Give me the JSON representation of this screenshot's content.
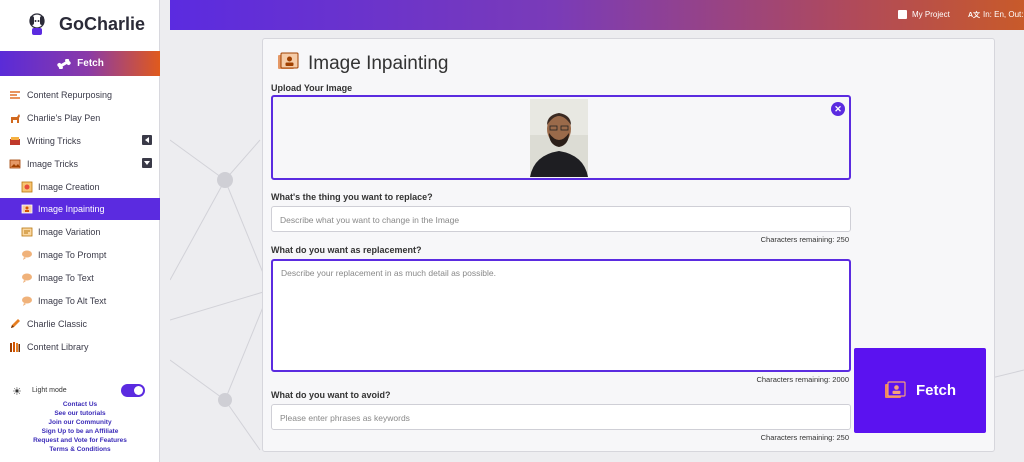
{
  "brand": {
    "name": "GoCharlie"
  },
  "sidebar": {
    "fetch_label": "Fetch",
    "items": [
      {
        "label": "Content Repurposing",
        "icon": "repurpose-icon"
      },
      {
        "label": "Charlie's Play Pen",
        "icon": "dog-icon"
      },
      {
        "label": "Writing Tricks",
        "icon": "writing-icon"
      },
      {
        "label": "Image Tricks",
        "icon": "image-icon"
      },
      {
        "label": "Image Creation",
        "icon": "image-creation-icon"
      },
      {
        "label": "Image Inpainting",
        "icon": "image-inpainting-icon",
        "active": true
      },
      {
        "label": "Image Variation",
        "icon": "image-variation-icon"
      },
      {
        "label": "Image To Prompt",
        "icon": "image-to-prompt-icon"
      },
      {
        "label": "Image To Text",
        "icon": "image-to-text-icon"
      },
      {
        "label": "Image To Alt Text",
        "icon": "image-to-alt-text-icon"
      },
      {
        "label": "Charlie Classic",
        "icon": "pencil-icon"
      },
      {
        "label": "Content Library",
        "icon": "library-icon"
      }
    ],
    "light_mode_label": "Light mode",
    "footer_links": [
      "Contact Us",
      "See our tutorials",
      "Join our Community",
      "Sign Up to be an Affiliate",
      "Request and Vote for Features",
      "Terms & Conditions"
    ]
  },
  "topbar": {
    "project_label": "My Project",
    "language_label": "In: En, Out:"
  },
  "main": {
    "title": "Image Inpainting",
    "upload_label": "Upload Your Image",
    "replace_label": "What's the thing you want to replace?",
    "replace_placeholder": "Describe what you want to change in the Image",
    "replace_count": "Characters remaining: 250",
    "replacement_label": "What do you want as replacement?",
    "replacement_placeholder": "Describe your replacement in as much detail as possible.",
    "replacement_count": "Characters remaining: 2000",
    "avoid_label": "What do you want to avoid?",
    "avoid_placeholder": "Please enter phrases as keywords",
    "avoid_count": "Characters remaining: 250",
    "fetch_button": "Fetch"
  },
  "colors": {
    "accent": "#5b2be0",
    "fetch_button": "#5b12f0"
  }
}
